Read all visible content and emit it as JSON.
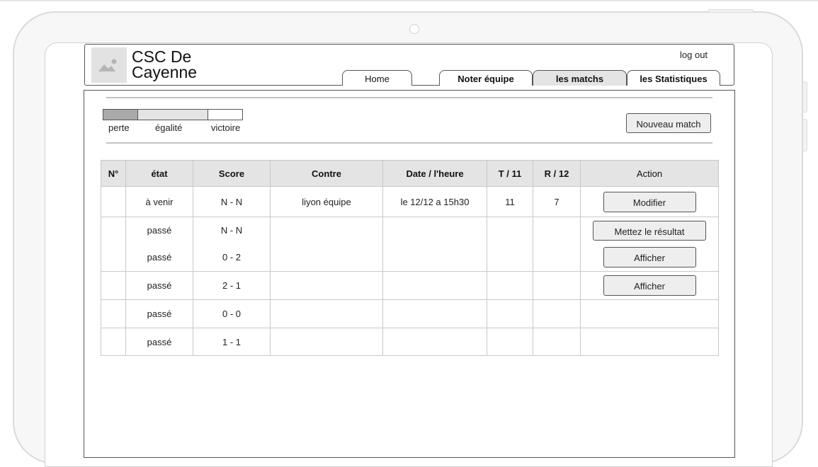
{
  "app": {
    "title": "CSC De Cayenne"
  },
  "header": {
    "logout_label": "log out",
    "logo_icon": "image-placeholder-icon"
  },
  "nav": {
    "tabs": [
      {
        "label": "Home",
        "active": false
      },
      {
        "label": "Noter équipe",
        "active": false
      },
      {
        "label": "les matchs",
        "active": true
      },
      {
        "label": "les Statistiques",
        "active": false
      }
    ]
  },
  "legend": {
    "items": [
      {
        "label": "perte",
        "color": "#aaaaaa"
      },
      {
        "label": "égalité",
        "color": "#e4e4e4"
      },
      {
        "label": "victoire",
        "color": "#ffffff"
      }
    ]
  },
  "toolbar": {
    "new_match_label": "Nouveau match"
  },
  "table": {
    "columns": [
      "N°",
      "état",
      "Score",
      "Contre",
      "Date / l'heure",
      "T / 11",
      "R / 12",
      "Action"
    ],
    "rows": [
      {
        "num": "",
        "etat": "à venir",
        "score": "N - N",
        "contre": "liyon équipe",
        "date": "le 12/12  a  15h30",
        "t": "11",
        "r": "7",
        "action": "Modifier"
      },
      {
        "num": "",
        "etat": "passé",
        "score": "N - N",
        "contre": "",
        "date": "",
        "t": "",
        "r": "",
        "action": "Mettez le résultat"
      },
      {
        "num": "",
        "etat": "passé",
        "score": "0 - 2",
        "contre": "",
        "date": "",
        "t": "",
        "r": "",
        "action": "Afficher"
      },
      {
        "num": "",
        "etat": "passé",
        "score": "2 - 1",
        "contre": "",
        "date": "",
        "t": "",
        "r": "",
        "action": "Afficher"
      },
      {
        "num": "",
        "etat": "passé",
        "score": "0 - 0",
        "contre": "",
        "date": "",
        "t": "",
        "r": "",
        "action": ""
      },
      {
        "num": "",
        "etat": "passé",
        "score": "1 - 1",
        "contre": "",
        "date": "",
        "t": "",
        "r": "",
        "action": ""
      }
    ]
  }
}
